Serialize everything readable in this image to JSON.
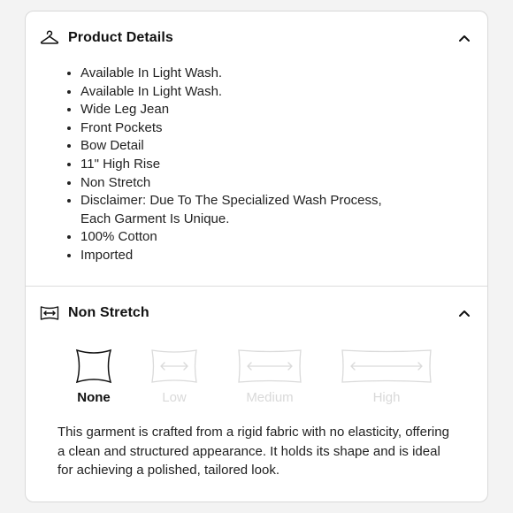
{
  "product_details": {
    "title": "Product Details",
    "icon": "hanger-icon",
    "expanded": true,
    "items": [
      "Available In Light Wash.",
      "Available In Light Wash.",
      "Wide Leg Jean",
      "Front Pockets",
      "Bow Detail",
      "11\" High Rise",
      "Non Stretch",
      "Disclaimer: Due To The Specialized Wash Process, Each Garment Is Unique.",
      "100% Cotton",
      "Imported"
    ]
  },
  "stretch": {
    "title": "Non Stretch",
    "icon": "fabric-stretch-icon",
    "expanded": true,
    "selected": "None",
    "options": [
      {
        "label": "None",
        "active": true
      },
      {
        "label": "Low",
        "active": false
      },
      {
        "label": "Medium",
        "active": false
      },
      {
        "label": "High",
        "active": false
      }
    ],
    "description": "This garment is crafted from a rigid fabric with no elasticity, offering a clean and structured appearance. It holds its shape and is ideal for achieving a polished, tailored look."
  },
  "colors": {
    "active": "#111111",
    "inactive": "#d9d9d9",
    "border": "#d9d9d9"
  }
}
